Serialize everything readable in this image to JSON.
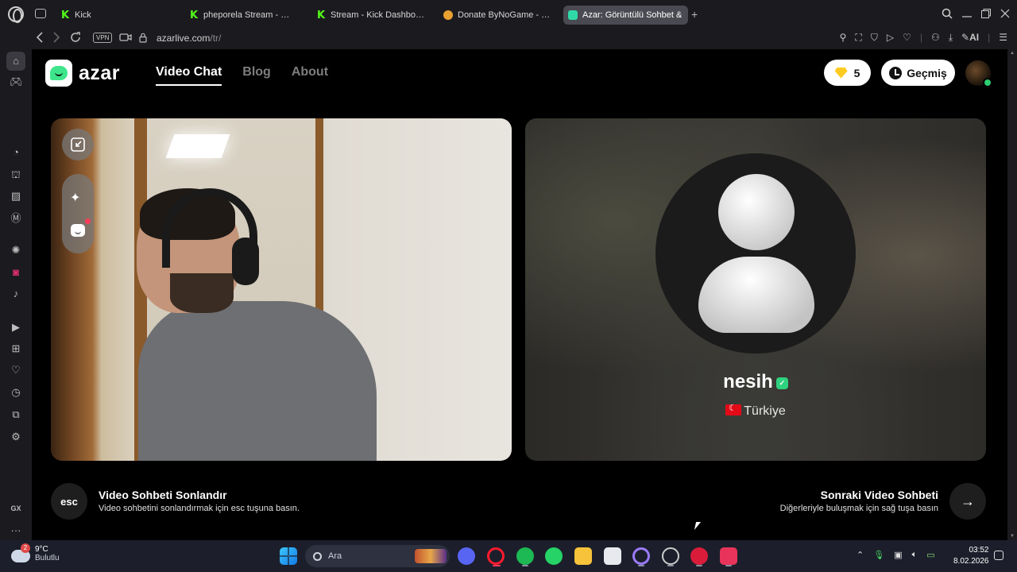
{
  "browser": {
    "tabs": [
      {
        "label": "Kick",
        "favicon": "kick-icon",
        "active": false
      },
      {
        "label": "pheporela Stream - Watch",
        "favicon": "kick-icon",
        "active": false
      },
      {
        "label": "Stream - Kick Dashboard",
        "favicon": "kick-icon",
        "active": false
      },
      {
        "label": "Donate ByNoGame - Gele",
        "favicon": "bynogame-icon",
        "active": false
      },
      {
        "label": "Azar: Görüntülü Sohbet &",
        "favicon": "azar-icon",
        "active": true
      }
    ],
    "new_tab_symbol": "+",
    "vpn_label": "VPN",
    "url_host": "azarlive.com",
    "url_path": "/tr/",
    "ai_label": "AI"
  },
  "sidebar": {
    "gx_label": "GX",
    "more_symbol": "···",
    "items": [
      "home-icon",
      "gamepad-icon",
      "speed-dial-icon",
      "twitch-icon",
      "cheat-icon",
      "m-icon",
      "chatgpt-icon",
      "instagram-icon",
      "tiktok-icon",
      "player-icon",
      "apps-icon",
      "heart-icon",
      "history-icon",
      "extensions-icon",
      "settings-icon"
    ]
  },
  "site": {
    "logo_text": "azar",
    "nav": [
      {
        "label": "Video Chat",
        "active": true
      },
      {
        "label": "Blog",
        "active": false
      },
      {
        "label": "About",
        "active": false
      }
    ],
    "gems_count": "5",
    "history_label": "Geçmiş"
  },
  "peer": {
    "name": "nesih",
    "country": "Türkiye"
  },
  "controls": {
    "esc_key": "esc",
    "end_title": "Video Sohbeti Sonlandır",
    "end_desc": "Video sohbetini sonlandırmak için esc tuşuna basın.",
    "next_title": "Sonraki Video Sohbeti",
    "next_desc": "Diğerleriyle buluşmak için sağ tuşa basın",
    "next_symbol": "→"
  },
  "taskbar": {
    "weather_temp": "9°C",
    "weather_desc": "Bulutlu",
    "weather_badge": "2",
    "search_placeholder": "Ara",
    "time": "03:52",
    "date": "8.02.2026"
  },
  "colors": {
    "accent_green": "#3ee58a",
    "gem_yellow": "#ffcb21",
    "kick_green": "#53fc18"
  }
}
